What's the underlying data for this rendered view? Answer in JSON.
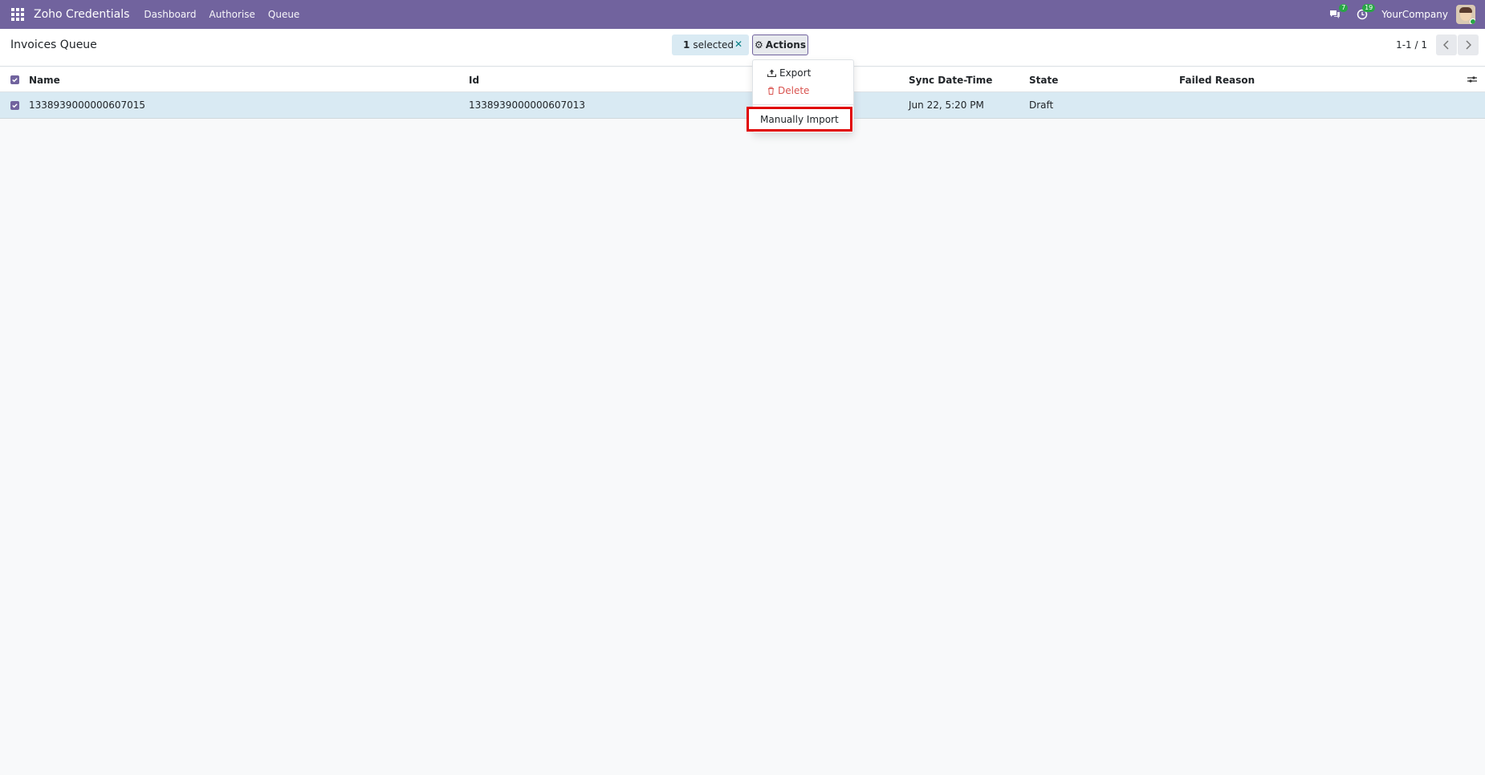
{
  "navbar": {
    "brand": "Zoho Credentials",
    "menu": [
      "Dashboard",
      "Authorise",
      "Queue"
    ],
    "messages_badge": "7",
    "activities_badge": "19",
    "company": "YourCompany",
    "color": "#71639e"
  },
  "control": {
    "title": "Invoices Queue",
    "selected_count": "1",
    "selected_label": "selected",
    "actions_label": "Actions",
    "pager": "1-1 / 1"
  },
  "table": {
    "columns": [
      "Name",
      "Id",
      "Sync Date-Time",
      "State",
      "Failed Reason"
    ],
    "rows": [
      {
        "name": "1338939000000607015",
        "id": "1338939000000607013",
        "sync": "Jun 22, 5:20 PM",
        "state": "Draft",
        "failed": ""
      }
    ]
  },
  "actions_menu": {
    "export": "Export",
    "delete": "Delete",
    "manual_import": "Manually Import"
  }
}
